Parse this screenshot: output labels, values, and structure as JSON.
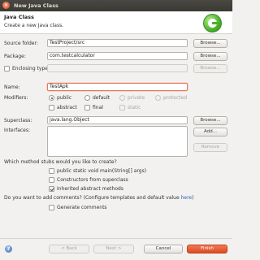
{
  "window": {
    "title": "New Java Class"
  },
  "header": {
    "title": "Java Class",
    "description": "Create a new Java class."
  },
  "source_folder": {
    "label": "Source folder:",
    "value": "TestProject/src",
    "browse_label": "Browse..."
  },
  "package": {
    "label": "Package:",
    "value": "com.testcalculator",
    "browse_label": "Browse..."
  },
  "enclosing_type": {
    "label": "Enclosing type:",
    "value": "",
    "browse_label": "Browse...",
    "checked": false
  },
  "name": {
    "label": "Name:",
    "value": "TestApk"
  },
  "modifiers": {
    "label": "Modifiers:",
    "access": [
      "public",
      "default",
      "private",
      "protected"
    ],
    "selected": "public",
    "other": [
      "abstract",
      "final",
      "static"
    ]
  },
  "superclass": {
    "label": "Superclass:",
    "value": "java.lang.Object",
    "browse_label": "Browse..."
  },
  "interfaces": {
    "label": "Interfaces:",
    "add_label": "Add...",
    "remove_label": "Remove",
    "items": []
  },
  "stubs": {
    "question": "Which method stubs would you like to create?",
    "options": [
      {
        "label": "public static void main(String[] args)",
        "checked": false
      },
      {
        "label": "Constructors from superclass",
        "checked": false
      },
      {
        "label": "Inherited abstract methods",
        "checked": true
      }
    ]
  },
  "comments": {
    "question_prefix": "Do you want to add comments? (Configure templates and default value ",
    "link_text": "here",
    "question_suffix": ")",
    "generate_label": "Generate comments",
    "checked": false
  },
  "footer": {
    "back_label": "< Back",
    "next_label": "Next >",
    "cancel_label": "Cancel",
    "finish_label": "Finish"
  },
  "colors": {
    "accent": "#e1795b",
    "primary_button": "#dc4a21",
    "link": "#2d5fb4"
  }
}
